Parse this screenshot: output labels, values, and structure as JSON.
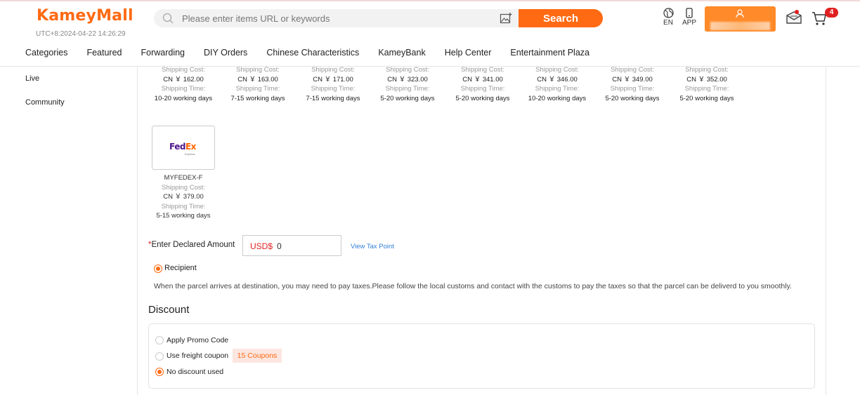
{
  "header": {
    "logo": "KameyMall",
    "clock": "UTC+8:2024-04-22 14:26:29",
    "search_placeholder": "Please enter items URL or keywords",
    "search_button": "Search",
    "language": "EN",
    "app_label": "APP",
    "cart_count": "4"
  },
  "nav": {
    "items": [
      "Categories",
      "Featured",
      "Forwarding",
      "DIY Orders",
      "Chinese Characteristics",
      "KameyBank",
      "Help Center",
      "Entertainment Plaza"
    ]
  },
  "sidebar": {
    "items": [
      "Live",
      "Community"
    ]
  },
  "shipping": {
    "cost_label": "Shipping Cost:",
    "time_label": "Shipping Time:",
    "options": [
      {
        "cost": "CN ￥ 162.00",
        "time": "10-20 working days"
      },
      {
        "cost": "CN ￥ 163.00",
        "time": "7-15 working days"
      },
      {
        "cost": "CN ￥ 171.00",
        "time": "7-15 working days"
      },
      {
        "cost": "CN ￥ 323.00",
        "time": "5-20 working days"
      },
      {
        "cost": "CN ￥ 341.00",
        "time": "5-20 working days"
      },
      {
        "cost": "CN ￥ 346.00",
        "time": "10-20 working days"
      },
      {
        "cost": "CN ￥ 349.00",
        "time": "5-20 working days"
      },
      {
        "cost": "CN ￥ 352.00",
        "time": "5-20 working days"
      }
    ],
    "fedex": {
      "logo_fe": "Fed",
      "logo_ex": "Ex",
      "logo_sub": "Express",
      "name": "MYFEDEX-F",
      "cost": "CN ￥ 379.00",
      "time": "5-15 working days"
    }
  },
  "declared": {
    "required_mark": "*",
    "label": "Enter Declared Amount",
    "currency": "USD$",
    "value": "0",
    "tax_link": "View Tax Point"
  },
  "tax_payer": {
    "recipient_label": "Recipient",
    "note": "When the parcel arrives at destination, you may need to pay taxes.Please follow the local customs and contact with the customs to pay the taxes so that the parcel can be deliverd to you smoothly."
  },
  "discount": {
    "title": "Discount",
    "promo_label": "Apply Promo Code",
    "freight_label": "Use freight coupon",
    "coupon_badge": "15 Coupons",
    "none_label": "No discount used"
  },
  "colors": {
    "brand": "#ff6a13",
    "link": "#2f7fd8",
    "badge": "#e02020"
  }
}
